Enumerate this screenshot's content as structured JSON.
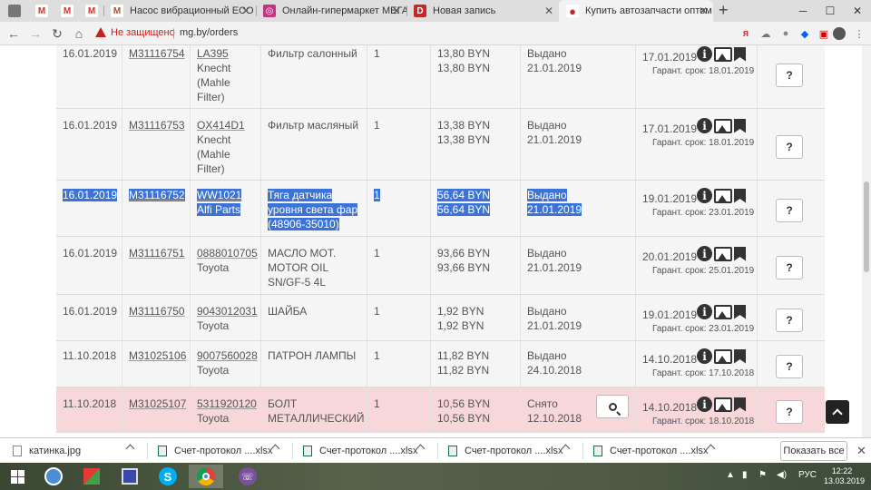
{
  "browser": {
    "tabs": [
      {
        "title": "",
        "favicon": "apple-icon",
        "color": "#666666",
        "glyph": ""
      },
      {
        "title": "",
        "favicon": "gmail-icon",
        "color": "#d93025",
        "glyph": "M"
      },
      {
        "title": "",
        "favicon": "gmail-icon",
        "color": "#d93025",
        "glyph": "M"
      },
      {
        "title": "",
        "favicon": "gmail-icon",
        "color": "#d93025",
        "glyph": "M"
      },
      {
        "title": "Насос вибрационный ECO CPV",
        "favicon": "site-icon",
        "color": "#a0522d",
        "glyph": "M"
      },
      {
        "title": "Онлайн-гипермаркет МЕГАЛАЙ",
        "favicon": "instagram-icon",
        "color": "#c13584",
        "glyph": "◎"
      },
      {
        "title": "Новая запись",
        "favicon": "drive2-icon",
        "color": "#c62828",
        "glyph": "D"
      },
      {
        "title": "Купить автозапчасти оптом и в",
        "favicon": "mg-icon",
        "color": "#c62828",
        "glyph": "●"
      }
    ],
    "security_warning": "Не защищено",
    "url": "mg.by/orders"
  },
  "orders": [
    {
      "date": "16.01.2019",
      "order": "M31116754",
      "article": "LA395",
      "brand": "Knecht (Mahle Filter)",
      "name": "Фильтр салонный",
      "qty": "1",
      "price": "13,80 BYN",
      "total": "13,80 BYN",
      "status": "Выдано",
      "status_date": "21.01.2019",
      "recv_date": "17.01.2019",
      "guarantee": "Гарант. срок: 18.01.2019",
      "action": "?",
      "style": "normal",
      "selected": false,
      "search": false
    },
    {
      "date": "16.01.2019",
      "order": "M31116753",
      "article": "OX414D1",
      "brand": "Knecht (Mahle Filter)",
      "name": "Фильтр масляный",
      "qty": "1",
      "price": "13,38 BYN",
      "total": "13,38 BYN",
      "status": "Выдано",
      "status_date": "21.01.2019",
      "recv_date": "17.01.2019",
      "guarantee": "Гарант. срок: 18.01.2019",
      "action": "?",
      "style": "normal",
      "selected": false,
      "search": false
    },
    {
      "date": "16.01.2019",
      "order": "M31116752",
      "article": "WW1021",
      "brand": "Alfi Parts",
      "name": "Тяга датчика уровня света фар (48906-35010)",
      "qty": "1",
      "price": "56,64 BYN",
      "total": "56,64 BYN",
      "status": "Выдано",
      "status_date": "21.01.2019",
      "recv_date": "19.01.2019",
      "guarantee": "Гарант. срок: 23.01.2019",
      "action": "?",
      "style": "normal",
      "selected": true,
      "search": false
    },
    {
      "date": "16.01.2019",
      "order": "M31116751",
      "article": "0888010705",
      "brand": "Toyota",
      "name": "МАСЛО МОТ. MOTOR OIL SN/GF-5 4L",
      "qty": "1",
      "price": "93,66 BYN",
      "total": "93,66 BYN",
      "status": "Выдано",
      "status_date": "21.01.2019",
      "recv_date": "20.01.2019",
      "guarantee": "Гарант. срок: 25.01.2019",
      "action": "?",
      "style": "normal",
      "selected": false,
      "search": false
    },
    {
      "date": "16.01.2019",
      "order": "M31116750",
      "article": "9043012031",
      "brand": "Toyota",
      "name": "ШАЙБА",
      "qty": "1",
      "price": "1,92 BYN",
      "total": "1,92 BYN",
      "status": "Выдано",
      "status_date": "21.01.2019",
      "recv_date": "19.01.2019",
      "guarantee": "Гарант. срок: 23.01.2019",
      "action": "?",
      "style": "normal",
      "selected": false,
      "search": false
    },
    {
      "date": "11.10.2018",
      "order": "M31025106",
      "article": "9007560028",
      "brand": "Toyota",
      "name": "ПАТРОН ЛАМПЫ",
      "qty": "1",
      "price": "11,82 BYN",
      "total": "11,82 BYN",
      "status": "Выдано",
      "status_date": "24.10.2018",
      "recv_date": "14.10.2018",
      "guarantee": "Гарант. срок: 17.10.2018",
      "action": "?",
      "style": "normal",
      "selected": false,
      "search": false
    },
    {
      "date": "11.10.2018",
      "order": "M31025107",
      "article": "5311920120",
      "brand": "Toyota",
      "name": "БОЛТ МЕТАЛЛИЧЕСКИЙ",
      "qty": "1",
      "price": "10,56 BYN",
      "total": "10,56 BYN",
      "status": "Снято",
      "status_date": "12.10.2018",
      "recv_date": "14.10.2018",
      "guarantee": "Гарант. срок: 18.10.2018",
      "action": "?",
      "style": "pink",
      "selected": false,
      "search": true
    }
  ],
  "downloads": {
    "items": [
      {
        "name": "катинка.jpg",
        "type": "jpg"
      },
      {
        "name": "Счет-протокол ....xlsx",
        "type": "xlsx"
      },
      {
        "name": "Счет-протокол ....xlsx",
        "type": "xlsx"
      },
      {
        "name": "Счет-протокол ....xlsx",
        "type": "xlsx"
      },
      {
        "name": "Счет-протокол ....xlsx",
        "type": "xlsx"
      }
    ],
    "show_all": "Показать все"
  },
  "taskbar": {
    "language": "РУС",
    "time": "12:22",
    "date": "13.03.2019"
  },
  "colors": {
    "selection": "#3b73d6",
    "pink_row": "#f8d7da",
    "row_bg": "#f5f5f5",
    "warning": "#c5221f"
  }
}
